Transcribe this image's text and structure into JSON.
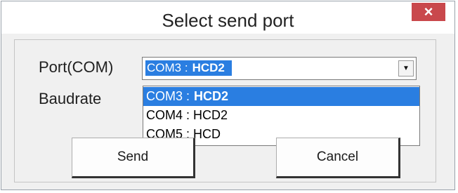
{
  "dialog": {
    "title": "Select send port",
    "close_label": "×"
  },
  "form": {
    "port_label": "Port(COM)",
    "baudrate_label": "Baudrate",
    "port_select": {
      "selected_prefix": "COM3 :",
      "selected_device": "HCD2",
      "arrow": "▼"
    },
    "port_options": [
      {
        "port": "COM3 :",
        "device": "HCD2",
        "selected": true
      },
      {
        "port": "COM4 :",
        "device": "HCD2",
        "selected": false
      },
      {
        "port": "COM5 :",
        "device": "HCD",
        "selected": false
      }
    ]
  },
  "buttons": {
    "send_label": "Send",
    "cancel_label": "Cancel"
  },
  "colors": {
    "selection": "#2a7ee1",
    "close_button": "#c9484c"
  }
}
